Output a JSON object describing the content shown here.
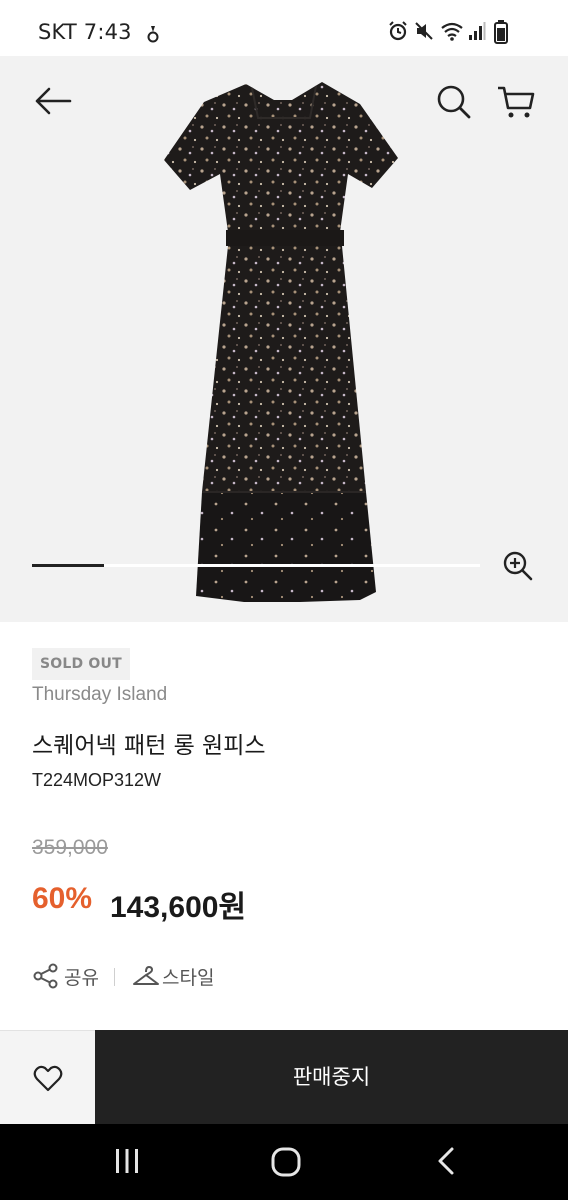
{
  "status_bar": {
    "carrier_time": "SKT 7:43",
    "icons": [
      "alarm-icon",
      "mute-icon",
      "wifi-icon",
      "signal-icon",
      "battery-icon"
    ]
  },
  "header": {
    "back_icon": "back-arrow-icon",
    "search_icon": "search-icon",
    "cart_icon": "cart-icon"
  },
  "gallery": {
    "zoom_icon": "zoom-in-icon",
    "progress": 0.16
  },
  "product": {
    "badge": "SOLD OUT",
    "brand": "Thursday Island",
    "name": "스퀘어넥 패턴 롱 원피스",
    "code": "T224MOP312W",
    "original_price": "359,000",
    "discount": "60%",
    "sale_price": "143,600원"
  },
  "actions": {
    "share_label": "공유",
    "style_label": "스타일"
  },
  "bottom_bar": {
    "wishlist_icon": "heart-icon",
    "buy_label": "판매중지"
  },
  "colors": {
    "accent": "#e5602d",
    "dark": "#222222",
    "hero_bg": "#f2f2f2"
  },
  "nav_bar": {
    "icons": [
      "recent-apps-icon",
      "home-icon",
      "back-icon"
    ]
  }
}
